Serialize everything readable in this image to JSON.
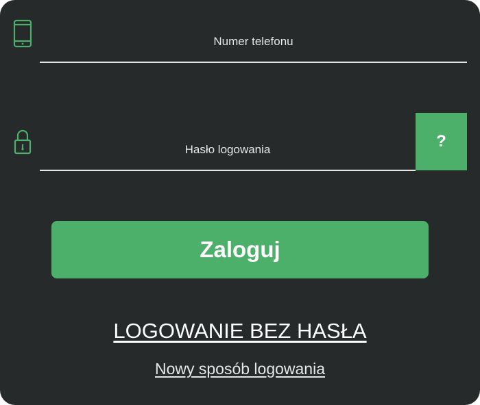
{
  "form": {
    "phone": {
      "placeholder": "Numer telefonu",
      "icon": "phone-icon"
    },
    "password": {
      "placeholder": "Hasło logowania",
      "icon": "lock-icon",
      "help_label": "?"
    },
    "login_label": "Zaloguj"
  },
  "links": {
    "passwordless_label": "LOGOWANIE BEZ HASŁA",
    "new_method_label": "Nowy sposób logowania"
  },
  "colors": {
    "background": "#272a2b",
    "accent": "#4caf6a",
    "text": "#e6e6e6"
  }
}
